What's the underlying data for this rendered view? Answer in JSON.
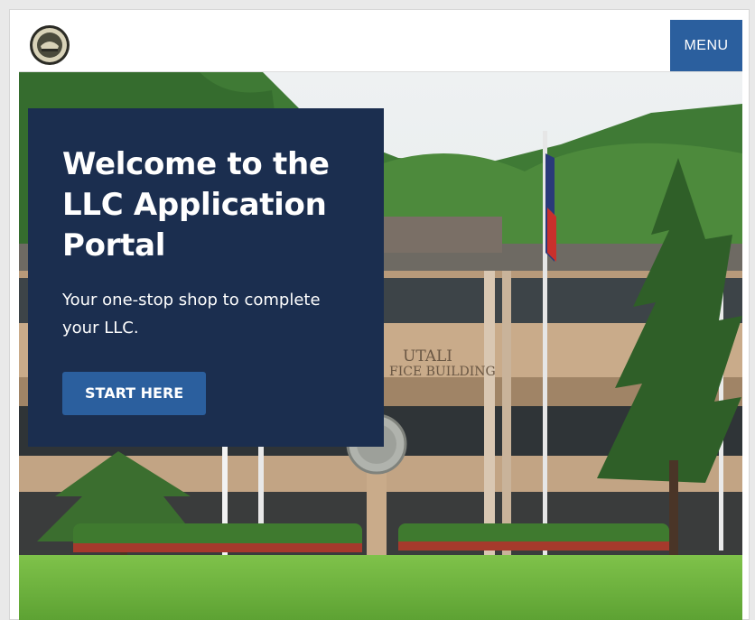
{
  "header": {
    "menu_label": "MENU",
    "logo_icon": "territorial-seal-icon"
  },
  "hero": {
    "title": "Welcome to the LLC Application Portal",
    "subtitle": "Your one-stop shop to complete your LLC.",
    "cta_label": "START HERE",
    "background_image": "government-office-building-photo"
  },
  "building_sign": {
    "line1": "UTALI",
    "line2": "FICE BUILDING"
  },
  "colors": {
    "card_background": "#1b2e4f",
    "accent_blue": "#2b5f9e",
    "text_on_dark": "#ffffff"
  }
}
